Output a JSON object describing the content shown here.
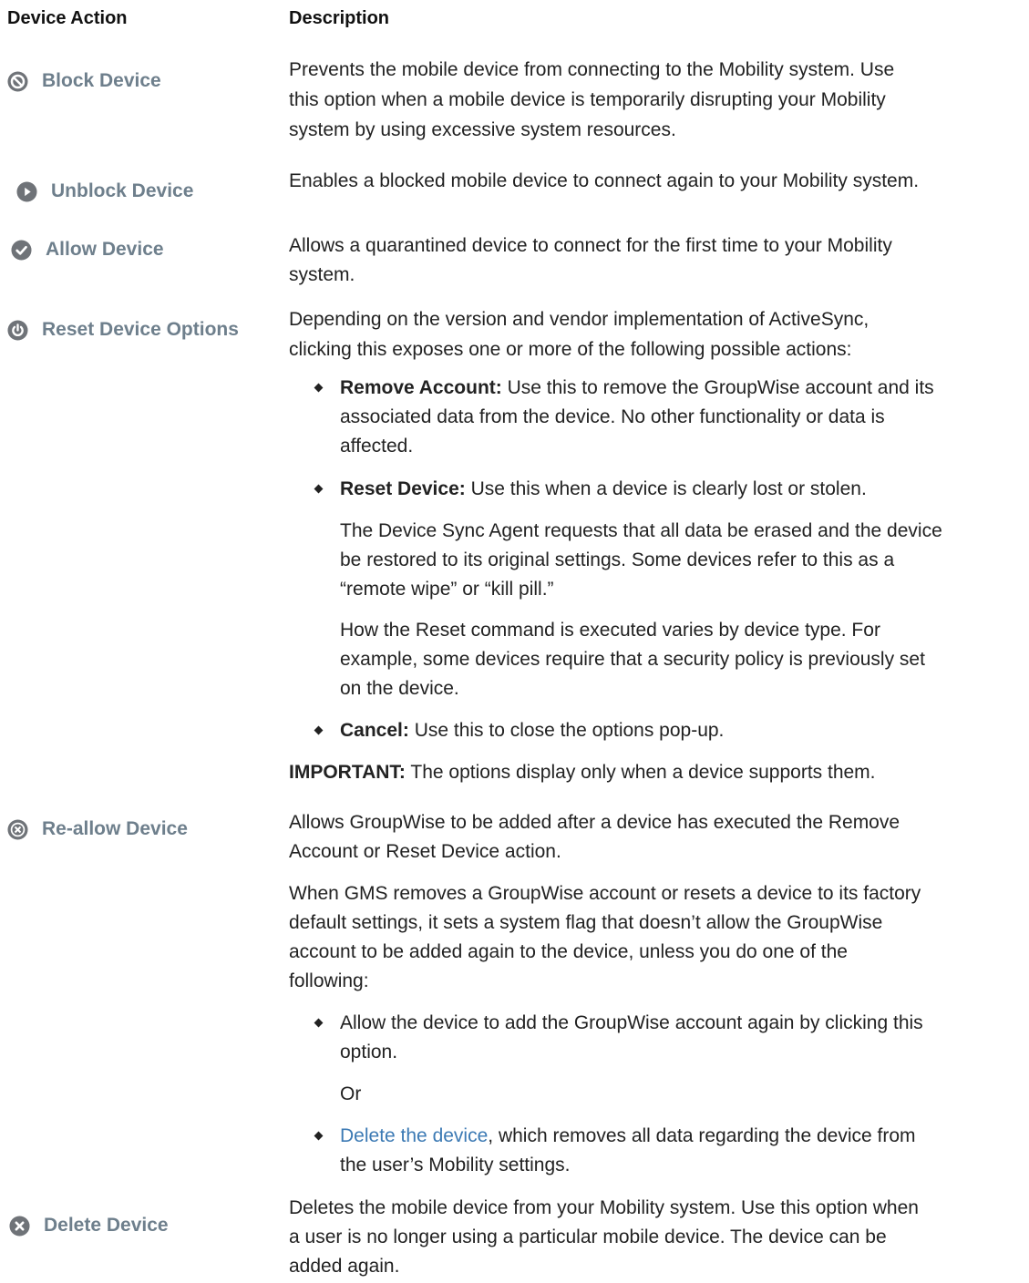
{
  "headers": {
    "action": "Device Action",
    "description": "Description"
  },
  "actions": {
    "block": {
      "label": "Block Device",
      "icon": "block-icon",
      "lines": [
        "Prevents the mobile device from connecting to the Mobility system. Use",
        "this option when a mobile device is temporarily disrupting your Mobility",
        "system by using excessive system resources."
      ]
    },
    "unblock": {
      "label": "Unblock Device",
      "icon": "play-icon",
      "lines": [
        "Enables a blocked mobile device to connect again to your Mobility system."
      ]
    },
    "allow": {
      "label": "Allow Device",
      "icon": "checkmark-icon",
      "lines": [
        "Allows a quarantined device to connect for the first time to your Mobility",
        "system."
      ]
    },
    "reset": {
      "label": "Reset Device Options",
      "icon": "power-icon",
      "lines": [
        "Depending on the version and vendor implementation of ActiveSync,",
        "clicking this exposes one or more of the following possible actions:"
      ],
      "remove_account": {
        "term": "Remove Account:",
        "first": " Use this to remove the GroupWise account and its",
        "rest": [
          "associated data from the device. No other functionality or data is",
          "affected."
        ]
      },
      "reset_device": {
        "term": "Reset Device:",
        "first": " Use this when a device is clearly lost or stolen.",
        "para1": [
          "The Device Sync Agent requests that all data be erased and the device",
          "be restored to its original settings. Some devices refer to this as a",
          "“remote wipe” or “kill pill.”"
        ],
        "para2": [
          "How the Reset command is executed varies by device type. For",
          "example, some devices require that a security policy is previously set",
          "on the device."
        ]
      },
      "cancel": {
        "term": "Cancel:",
        "first": " Use this to close the options pop-up."
      },
      "important": {
        "term": "IMPORTANT:",
        "text": " The options display only when a device supports them."
      }
    },
    "reallow": {
      "label": "Re-allow Device",
      "icon": "x-circle-icon",
      "lines": [
        "Allows GroupWise to be added after a device has executed the Remove",
        "Account or Reset Device action."
      ],
      "para2": [
        "When GMS removes a GroupWise account or resets a device to its factory",
        "default settings, it sets a system flag that doesn’t allow the GroupWise",
        "account to be added again to the device, unless you do one of the",
        "following:"
      ],
      "bullet1": [
        "Allow the device to add the GroupWise account again by clicking this",
        "option."
      ],
      "or": "Or",
      "bullet2_link": "Delete the device",
      "bullet2_first": ", which removes all data regarding the device from",
      "bullet2_rest": "the user’s Mobility settings."
    },
    "delete": {
      "label": "Delete Device",
      "icon": "x-circle-filled-icon",
      "lines": [
        "Deletes the mobile device from your Mobility system. Use this option when",
        "a user is no longer using a particular mobile device. The device can be",
        "added again."
      ]
    }
  },
  "colors": {
    "label": "#6e7f8c",
    "icon": "#6f7378",
    "link": "#3c7ab4"
  }
}
